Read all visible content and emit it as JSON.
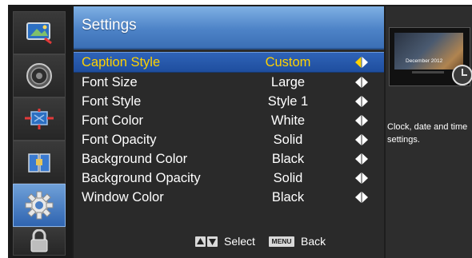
{
  "colors": {
    "header_blue": "#4d83c7",
    "selection_blue": "#2f63b8",
    "selected_text": "#ffd200",
    "arrow_yellow": "#ffd200",
    "background": "#2a2a2a"
  },
  "rail": {
    "items": [
      {
        "name": "picture",
        "icon": "picture-icon",
        "active": false
      },
      {
        "name": "sound",
        "icon": "speaker-icon",
        "active": false
      },
      {
        "name": "channel",
        "icon": "tv-signal-icon",
        "active": false
      },
      {
        "name": "parental",
        "icon": "parental-lock-icon",
        "active": false
      },
      {
        "name": "setup",
        "icon": "gear-icon",
        "active": true
      },
      {
        "name": "lock",
        "icon": "padlock-icon",
        "active": false
      }
    ]
  },
  "panel": {
    "title": "Settings"
  },
  "menu": [
    {
      "label": "Caption Style",
      "value": "Custom",
      "selected": true
    },
    {
      "label": "Font Size",
      "value": "Large",
      "selected": false
    },
    {
      "label": "Font Style",
      "value": "Style 1",
      "selected": false
    },
    {
      "label": "Font Color",
      "value": "White",
      "selected": false
    },
    {
      "label": "Font Opacity",
      "value": "Solid",
      "selected": false
    },
    {
      "label": "Background Color",
      "value": "Black",
      "selected": false
    },
    {
      "label": "Background Opacity",
      "value": "Solid",
      "selected": false
    },
    {
      "label": "Window Color",
      "value": "Black",
      "selected": false
    }
  ],
  "hint": {
    "select": "Select",
    "menu_key": "MENU",
    "back": "Back"
  },
  "info": {
    "preview_date": "December 2012",
    "description": "Clock, date and time settings."
  }
}
